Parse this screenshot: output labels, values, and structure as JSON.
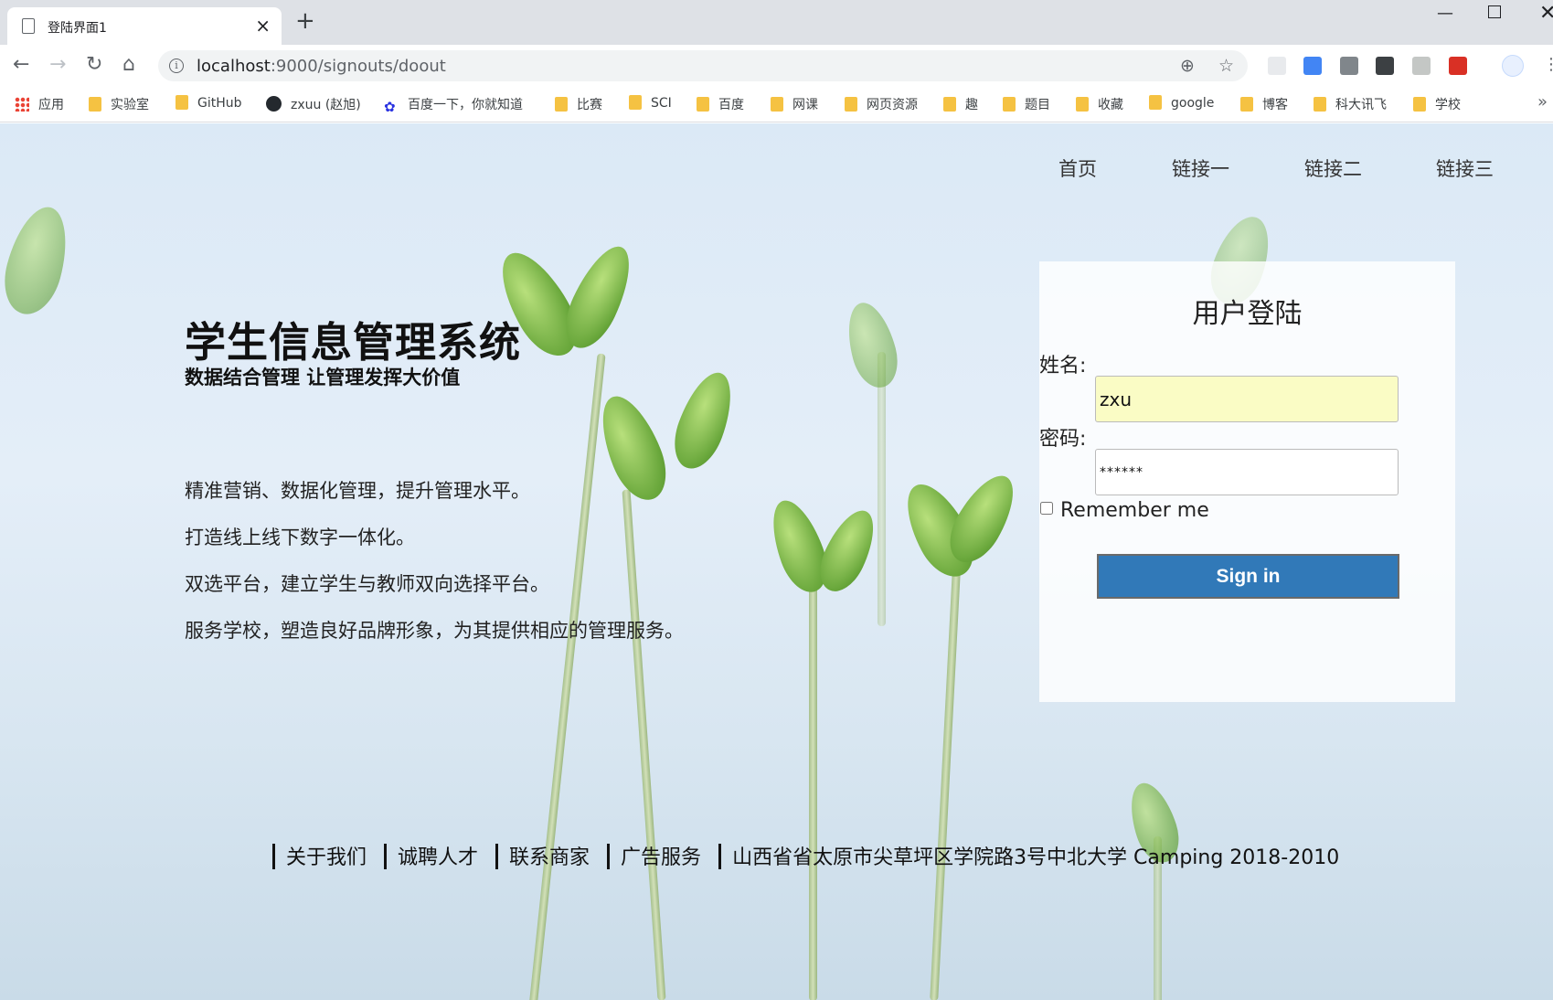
{
  "browser": {
    "tab_title": "登陆界面1",
    "url_host": "localhost",
    "url_path": ":9000/signouts/doout",
    "bookmarks": [
      "应用",
      "实验室",
      "GitHub",
      "zxuu (赵旭)",
      "百度一下，你就知道",
      "比赛",
      "SCI",
      "百度",
      "网课",
      "网页资源",
      "趣",
      "题目",
      "收藏",
      "google",
      "博客",
      "科大讯飞",
      "学校"
    ]
  },
  "nav": {
    "items": [
      "首页",
      "链接一",
      "链接二",
      "链接三"
    ]
  },
  "hero": {
    "title": "学生信息管理系统",
    "subtitle": "数据结合管理 让管理发挥大价值",
    "features": [
      "精准营销、数据化管理，提升管理水平。",
      "打造线上线下数字一体化。",
      "双选平台，建立学生与教师双向选择平台。",
      "服务学校，塑造良好品牌形象，为其提供相应的管理服务。"
    ]
  },
  "login": {
    "title": "用户登陆",
    "name_label": "姓名:",
    "name_value": "zxu",
    "password_label": "密码:",
    "password_value": "******",
    "remember_label": "Remember me",
    "submit_label": "Sign in"
  },
  "footer": {
    "links": [
      "关于我们",
      "诚聘人才",
      "联系商家",
      "广告服务"
    ],
    "address": "山西省省太原市尖草坪区学院路3号中北大学 Camping 2018-2010"
  }
}
